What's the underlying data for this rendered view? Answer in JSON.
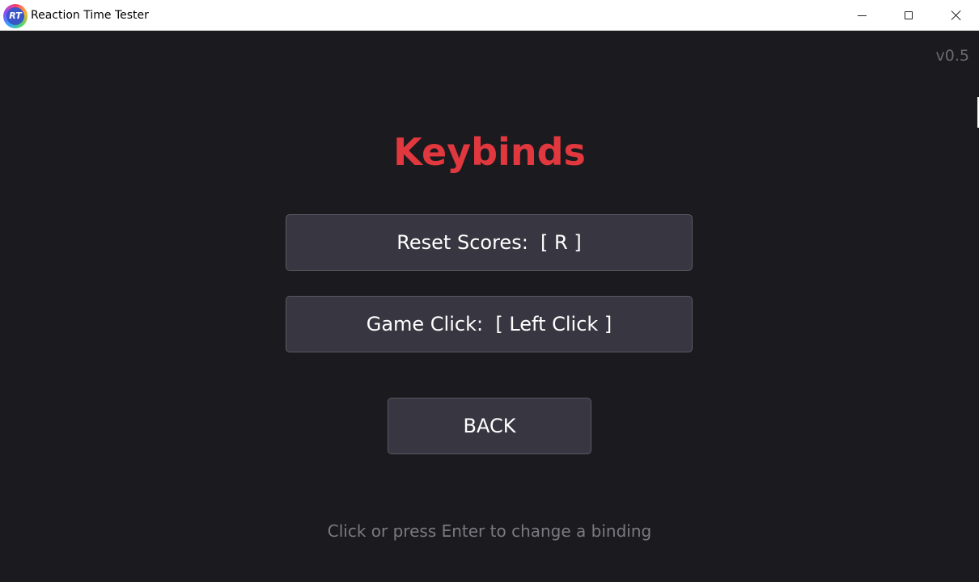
{
  "window": {
    "title": "Reaction Time Tester",
    "icon_text": "RT",
    "icon_name": "app-logo-icon",
    "controls": {
      "minimize_icon": "minimize-icon",
      "maximize_icon": "maximize-icon",
      "close_icon": "close-icon"
    }
  },
  "app": {
    "version": "v0.5",
    "heading": "Keybinds",
    "heading_color": "#e0383e",
    "bindings": [
      {
        "label": "Reset Scores:",
        "key": "[ R ]",
        "display": "Reset Scores:  [ R ]"
      },
      {
        "label": "Game Click:",
        "key": "[ Left Click ]",
        "display": "Game Click:  [ Left Click ]"
      }
    ],
    "back_label": "BACK",
    "hint": "Click or press Enter to change a binding"
  },
  "colors": {
    "background": "#1b1a1e",
    "button_background": "#383741",
    "button_border": "#5a5963",
    "text_muted": "#7b7a82"
  }
}
